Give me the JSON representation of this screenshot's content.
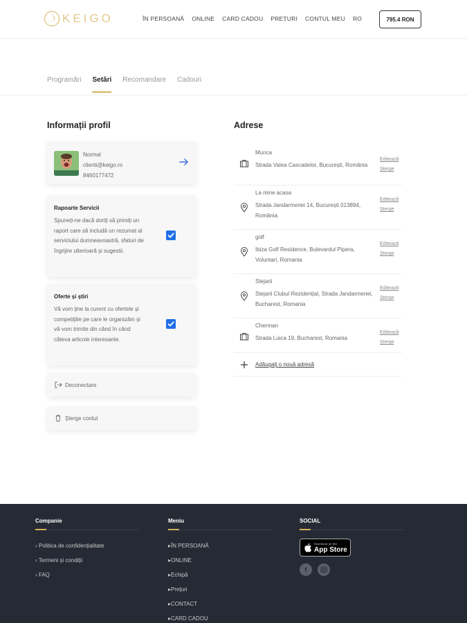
{
  "header": {
    "logo_text": "KEIGO",
    "nav": [
      "ÎN PERSOANĂ",
      "ONLINE",
      "CARD CADOU",
      "PREȚURI",
      "CONTUL MEU",
      "RO"
    ],
    "balance": "795.4 RON"
  },
  "tabs": [
    "Programări",
    "Setări",
    "Recomandare",
    "Cadouri"
  ],
  "active_tab": "Setări",
  "profile": {
    "section_title": "Informații profil",
    "name": "Normal",
    "email": "clienti@keigo.ro",
    "phone": "8460177472"
  },
  "preferences": [
    {
      "title": "Rapoarte Servicii",
      "text": "Spuneți-ne dacă doriți să primiți un raport care să includă un rezumat al serviciului dumneavoastră, sfaturi de îngrijire ulterioară și sugestii.",
      "checked": true
    },
    {
      "title": "Oferte și știri",
      "text": "Vă vom ține la curent cu ofertele și competițiile pe care le organizăm și vă vom trimite din când în când câteva articole interesante.",
      "checked": true
    }
  ],
  "actions": {
    "logout": "Deconectare",
    "delete_account": "Șterge contul"
  },
  "addresses": {
    "section_title": "Adrese",
    "edit_label": "Editează",
    "delete_label": "Șterge",
    "add_label": "Adăugați o nouă adresă",
    "items": [
      {
        "name": "Munca",
        "address": "Strada Valea Cascadelor, București, România",
        "icon": "briefcase-icon"
      },
      {
        "name": "La mine acasa",
        "address": "Strada Jandarmeriei 14, București 013894, România",
        "icon": "location-pin-icon"
      },
      {
        "name": "golf",
        "address": "Ibiza Golf Residence, Bulevardul Pipera, Voluntari, Romania",
        "icon": "location-pin-icon"
      },
      {
        "name": "Stejarii",
        "address": "Stejarii Clubul Rezidențial, Strada Jandarmeriei, Bucharest, Romania",
        "icon": "location-pin-icon"
      },
      {
        "name": "Cherman",
        "address": "Strada Luica 19, Bucharest, Romania",
        "icon": "briefcase-icon"
      }
    ]
  },
  "footer": {
    "company_title": "Companie",
    "company_links": [
      "Politica de confidențialitate",
      "Termeni și condiții",
      "FAQ"
    ],
    "menu_title": "Meniu",
    "menu_links": [
      "ÎN PERSOANĂ",
      "ONLINE",
      "Echipă",
      "Prețuri",
      "CONTACT",
      "CARD CADOU"
    ],
    "social_title": "SOCIAL",
    "appstore_small": "Download on the",
    "appstore_big": "App Store",
    "social_icons": [
      "facebook-icon",
      "instagram-icon"
    ]
  },
  "colors": {
    "accent": "#d8b25c",
    "checkbox": "#1f6fe5",
    "footer_bg": "#262a35"
  }
}
